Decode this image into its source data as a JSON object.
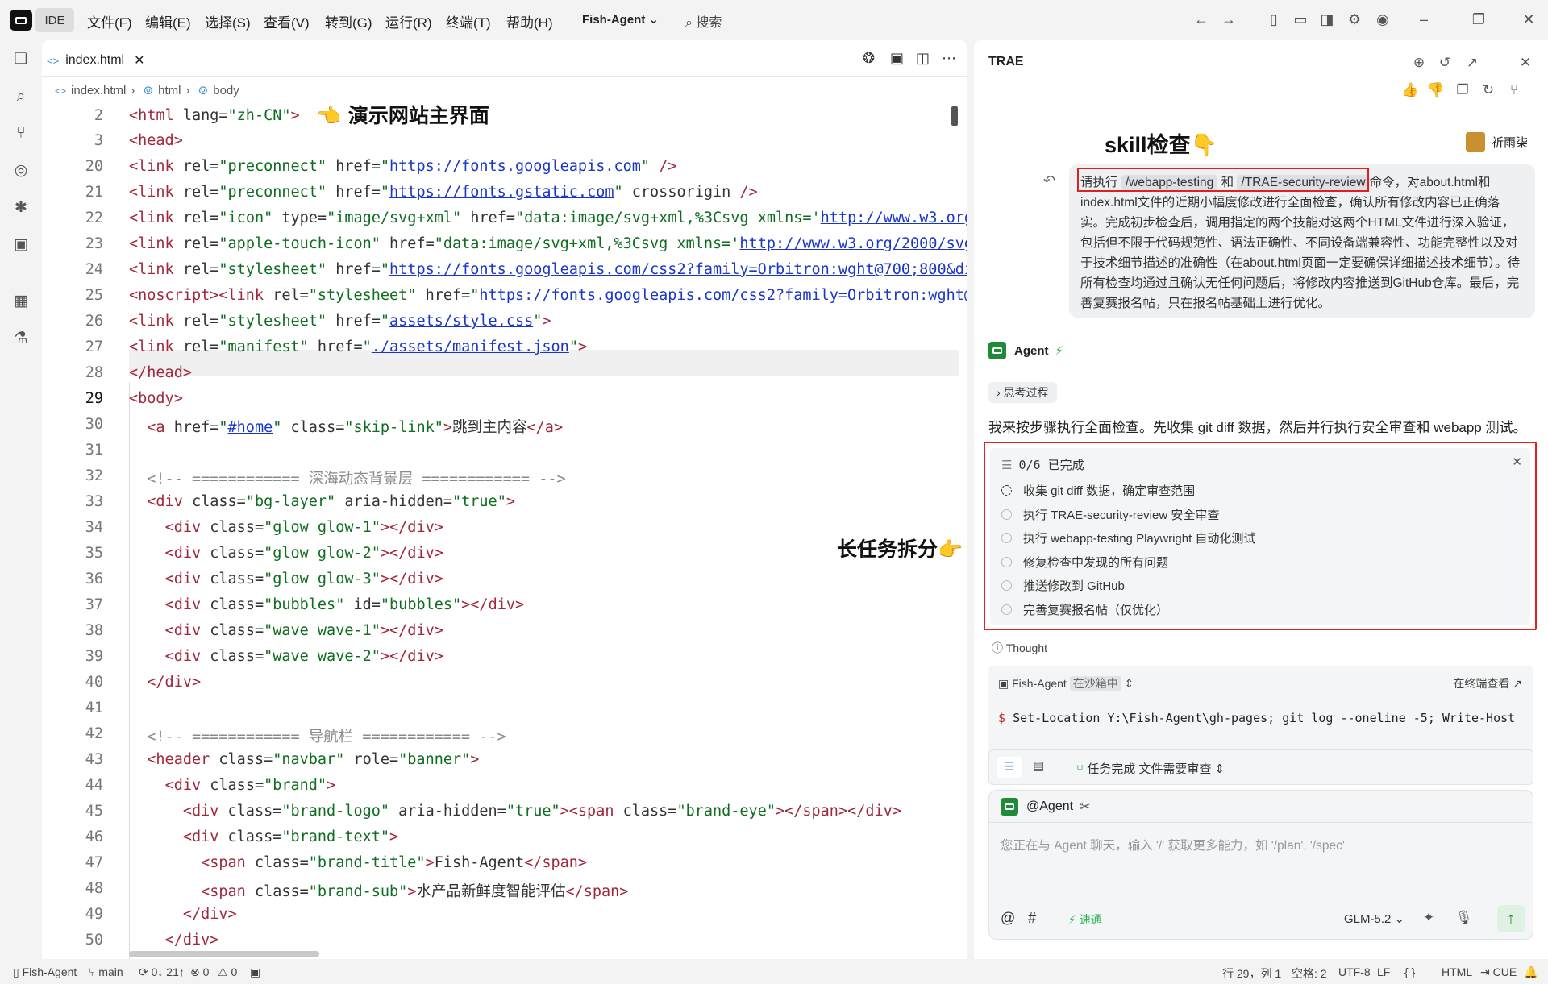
{
  "titlebar": {
    "ide_label": "IDE",
    "menus": [
      "文件(F)",
      "编辑(E)",
      "选择(S)",
      "查看(V)",
      "转到(G)",
      "运行(R)",
      "终端(T)",
      "帮助(H)"
    ],
    "project": "Fish-Agent",
    "search_label": "搜索"
  },
  "editor": {
    "tab_label": "index.html",
    "breadcrumb": [
      "index.html",
      "html",
      "body"
    ],
    "lines": [
      "2",
      "3",
      "20",
      "21",
      "22",
      "23",
      "24",
      "25",
      "26",
      "27",
      "28",
      "29",
      "30",
      "31",
      "32",
      "33",
      "34",
      "35",
      "36",
      "37",
      "38",
      "39",
      "40",
      "41",
      "42",
      "43",
      "44",
      "45",
      "46",
      "47",
      "48",
      "49",
      "50"
    ],
    "current_line": "29",
    "annotation_top": "👈 演示网站主界面",
    "annotation_mid": "长任务拆分👉"
  },
  "panel": {
    "title": "TRAE",
    "skill_heading": "skill检查👇",
    "user_name": "祈雨柒",
    "message_prefix": "请执行",
    "chip1": "/webapp-testing",
    "and": "和",
    "chip2": "/TRAE-security-review",
    "message_rest": "命令，对about.html和index.html文件的近期小幅度修改进行全面检查，确认所有修改内容已正确落实。完成初步检查后，调用指定的两个技能对这两个HTML文件进行深入验证，包括但不限于代码规范性、语法正确性、不同设备端兼容性、功能完整性以及对于技术细节描述的准确性（在about.html页面一定要确保详细描述技术细节）。待所有检查均通过且确认无任何问题后，将修改内容推送到GitHub仓库。最后，完善复赛报名帖，只在报名帖基础上进行优化。",
    "agent_label": "Agent",
    "thinking_label": "思考过程",
    "reply": "我来按步骤执行全面检查。先收集 git diff 数据，然后并行执行安全审查和 webapp 测试。",
    "todo_progress": "0/6 已完成",
    "todos": [
      "收集 git diff 数据，确定审查范围",
      "执行 TRAE-security-review 安全审查",
      "执行 webapp-testing Playwright 自动化测试",
      "修复检查中发现的所有问题",
      "推送修改到 GitHub",
      "完善复赛报名帖（仅优化）"
    ],
    "thought_label": "Thought",
    "terminal_name": "Fish-Agent",
    "terminal_status": "在沙箱中",
    "terminal_open": "在终端查看",
    "terminal_cmd": "Set-Location Y:\\Fish-Agent\\gh-pages; git log --oneline -5; Write-Host",
    "task_status": "任务完成",
    "task_review": "文件需要审查",
    "mention": "@Agent",
    "input_placeholder": "您正在与 Agent 聊天，输入 '/' 获取更多能力，如 '/plan', '/spec'",
    "speed": "速通",
    "model": "GLM-5.2"
  },
  "statusbar": {
    "project": "Fish-Agent",
    "branch": "main",
    "sync": "0↓ 21↑",
    "errors": "0",
    "warnings": "0",
    "position": "行 29，列 1",
    "spaces": "空格: 2",
    "encoding": "UTF-8",
    "eol": "LF",
    "braces": "{ }",
    "language": "HTML",
    "cue": "CUE"
  },
  "colors": {
    "accent": "#1f8a3a",
    "highlight": "#e02020",
    "link": "#1a36c8",
    "tag": "#a0283c"
  }
}
